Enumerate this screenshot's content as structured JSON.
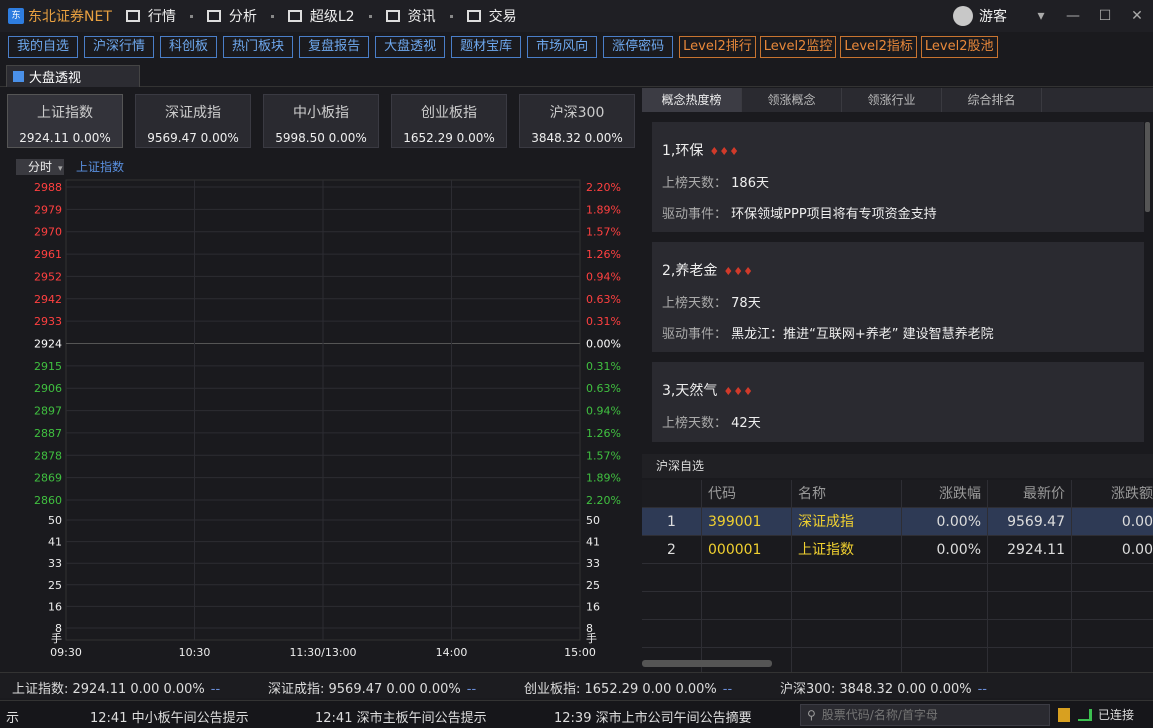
{
  "app": {
    "title": "东北证券NET",
    "logo_text": "NET"
  },
  "top_menu": [
    {
      "label": "行情",
      "icon": "bar-chart-icon"
    },
    {
      "label": "分析",
      "icon": "line-chart-icon"
    },
    {
      "label": "超级L2",
      "icon": "zoom-icon"
    },
    {
      "label": "资讯",
      "icon": "news-icon"
    },
    {
      "label": "交易",
      "icon": "trade-icon"
    }
  ],
  "user": {
    "name": "游客"
  },
  "quick_buttons": [
    "我的自选",
    "沪深行情",
    "科创板",
    "热门板块",
    "复盘报告",
    "大盘透视",
    "题材宝库",
    "市场风向",
    "涨停密码"
  ],
  "level2_buttons": [
    "Level2排行",
    "Level2监控",
    "Level2指标",
    "Level2股池"
  ],
  "main_tab": "大盘透视",
  "indices": [
    {
      "name": "上证指数",
      "value": "2924.11  0.00%"
    },
    {
      "name": "深证成指",
      "value": "9569.47  0.00%"
    },
    {
      "name": "中小板指",
      "value": "5998.50  0.00%"
    },
    {
      "name": "创业板指",
      "value": "1652.29  0.00%"
    },
    {
      "name": "沪深300",
      "value": "3848.32  0.00%"
    }
  ],
  "chart_controls": {
    "period": "分时",
    "series_label": "上证指数"
  },
  "chart_data": {
    "type": "line",
    "title": "上证指数",
    "y_left_ticks": [
      "2988",
      "2979",
      "2970",
      "2961",
      "2952",
      "2942",
      "2933",
      "2924",
      "2915",
      "2906",
      "2897",
      "2887",
      "2878",
      "2869",
      "2860"
    ],
    "y_right_ticks": [
      "2.20%",
      "1.89%",
      "1.57%",
      "1.26%",
      "0.94%",
      "0.63%",
      "0.31%",
      "0.00%",
      "0.31%",
      "0.63%",
      "0.94%",
      "1.26%",
      "1.57%",
      "1.89%",
      "2.20%"
    ],
    "volume_ticks": [
      "50",
      "41",
      "33",
      "25",
      "16",
      "8"
    ],
    "volume_unit": "手",
    "x_ticks": [
      "09:30",
      "10:30",
      "11:30/13:00",
      "14:00",
      "15:00"
    ],
    "base_value": 2924,
    "series": [
      {
        "values": []
      }
    ],
    "colors": {
      "up": "#ff4040",
      "down": "#40c040",
      "neutral": "#ffffff"
    }
  },
  "right_tabs": [
    "概念热度榜",
    "领涨概念",
    "领涨行业",
    "综合排名"
  ],
  "concepts": [
    {
      "title": "1,环保",
      "days_label": "上榜天数：",
      "days": "186天",
      "event_label": "驱动事件：",
      "event": "环保领域PPP项目将有专项资金支持"
    },
    {
      "title": "2,养老金",
      "days_label": "上榜天数：",
      "days": "78天",
      "event_label": "驱动事件：",
      "event": "黑龙江：推进“互联网+养老” 建设智慧养老院"
    },
    {
      "title": "3,天然气",
      "days_label": "上榜天数：",
      "days": "42天"
    }
  ],
  "fire_icons": "♦♦♦",
  "self_selected": {
    "title": "沪深自选",
    "headers": [
      "",
      "代码",
      "名称",
      "涨跌幅",
      "最新价",
      "涨跌额"
    ],
    "rows": [
      {
        "idx": "1",
        "code": "399001",
        "name": "深证成指",
        "change_pct": "0.00%",
        "price": "9569.47",
        "change": "0.00"
      },
      {
        "idx": "2",
        "code": "000001",
        "name": "上证指数",
        "change_pct": "0.00%",
        "price": "2924.11",
        "change": "0.00"
      }
    ]
  },
  "status_bar": [
    {
      "label": "上证指数: 2924.11  0.00  0.00%",
      "dash": "--"
    },
    {
      "label": "深证成指: 9569.47  0.00  0.00%",
      "dash": "--"
    },
    {
      "label": "创业板指: 1652.29  0.00  0.00%",
      "dash": "--"
    },
    {
      "label": "沪深300: 3848.32  0.00  0.00%",
      "dash": "--"
    }
  ],
  "news_bar": {
    "prefix": "示",
    "items": [
      "12:41 中小板午间公告提示",
      "12:41 深市主板午间公告提示",
      "12:39 深市上市公司午间公告摘要"
    ]
  },
  "search": {
    "placeholder": "股票代码/名称/首字母"
  },
  "connection": {
    "label": "已连接"
  }
}
